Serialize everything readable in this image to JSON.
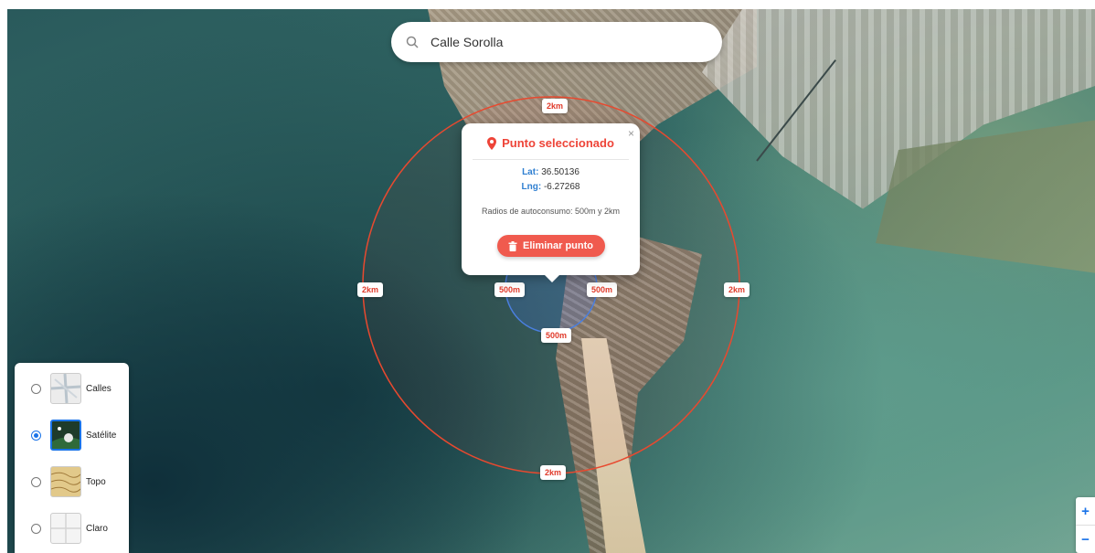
{
  "search": {
    "value": "Calle Sorolla",
    "icon": "search-icon"
  },
  "popup": {
    "title": "Punto seleccionado",
    "lat_label": "Lat:",
    "lat_value": "36.50136",
    "lng_label": "Lng:",
    "lng_value": "-6.27268",
    "radii_text": "Radios de autoconsumo: 500m y 2km",
    "delete_label": "Eliminar punto",
    "close": "×"
  },
  "radius_labels": {
    "outer": "2km",
    "inner": "500m"
  },
  "layers": [
    {
      "label": "Calles",
      "selected": false
    },
    {
      "label": "Satélite",
      "selected": true
    },
    {
      "label": "Topo",
      "selected": false
    },
    {
      "label": "Claro",
      "selected": false
    }
  ],
  "zoom": {
    "in": "+",
    "out": "−"
  },
  "colors": {
    "accent": "#ee4438",
    "blue": "#1a73e8",
    "coord": "#2f7fd1"
  }
}
